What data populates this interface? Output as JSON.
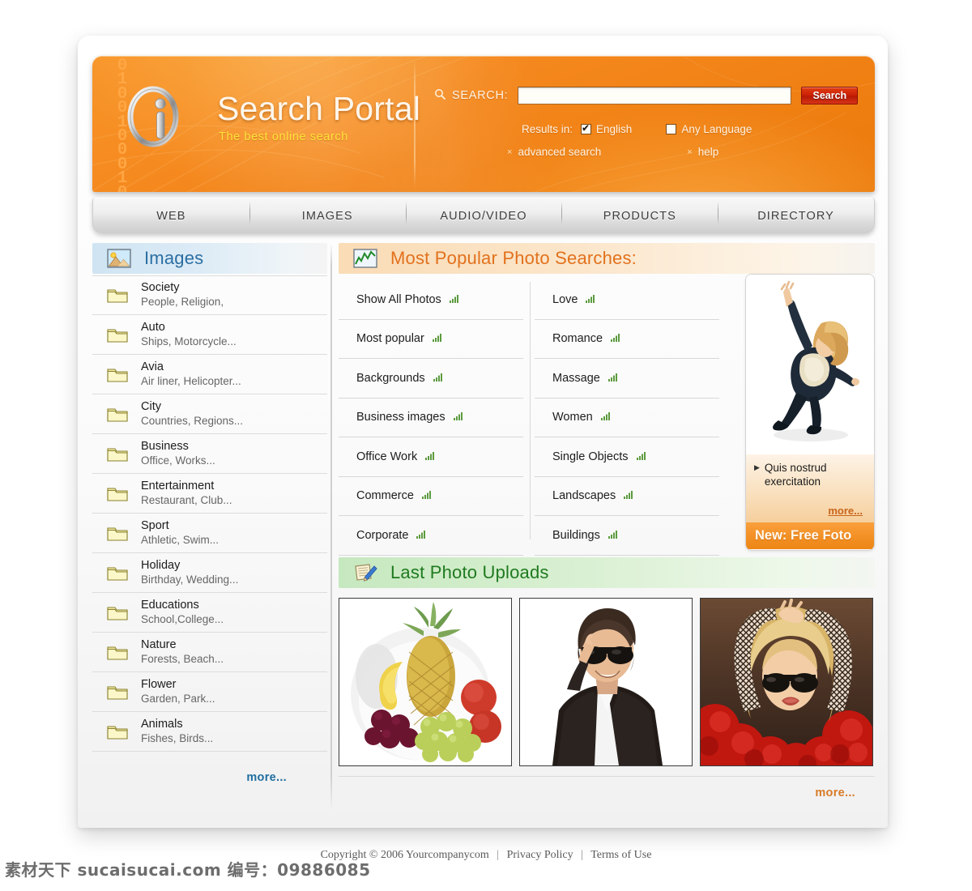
{
  "brand": {
    "title": "Search Portal",
    "tagline": "The best online search",
    "binary": "0\n1\n0\n0\n1\n0\n0\n0\n1\n0",
    "logo_icon": "info-circle-icon"
  },
  "search": {
    "icon": "magnifier-icon",
    "label": "SEARCH:",
    "value": "",
    "placeholder": "",
    "button_label": "Search",
    "results_in_label": "Results in:",
    "options": [
      {
        "label": "English",
        "checked": true
      },
      {
        "label": "Any Language",
        "checked": false
      }
    ],
    "links": [
      {
        "label": "advanced search",
        "bullet": "×"
      },
      {
        "label": "help",
        "bullet": "×"
      }
    ]
  },
  "nav": {
    "tabs": [
      {
        "label": "WEB"
      },
      {
        "label": "IMAGES"
      },
      {
        "label": "AUDIO/VIDEO"
      },
      {
        "label": "PRODUCTS"
      },
      {
        "label": "DIRECTORY"
      }
    ]
  },
  "sidebar": {
    "header": {
      "title": "Images",
      "icon": "picture-landscape-icon"
    },
    "items": [
      {
        "title": "Society",
        "sub": "People, Religion,"
      },
      {
        "title": "Auto",
        "sub": "Ships, Motorcycle..."
      },
      {
        "title": "Avia",
        "sub": "Air liner, Helicopter..."
      },
      {
        "title": "City",
        "sub": "Countries, Regions..."
      },
      {
        "title": "Business",
        "sub": "Office, Works..."
      },
      {
        "title": "Entertainment",
        "sub": "Restaurant, Club..."
      },
      {
        "title": "Sport",
        "sub": "Athletic, Swim..."
      },
      {
        "title": "Holiday",
        "sub": "Birthday, Wedding..."
      },
      {
        "title": "Educations",
        "sub": "School,College..."
      },
      {
        "title": "Nature",
        "sub": "Forests, Beach..."
      },
      {
        "title": "Flower",
        "sub": "Garden, Park..."
      },
      {
        "title": "Animals",
        "sub": "Fishes, Birds..."
      }
    ],
    "more_label": "more..."
  },
  "popular": {
    "header": {
      "title": "Most Popular Photo Searches:",
      "icon": "chart-line-icon"
    },
    "left_column": [
      {
        "label": "Show All Photos"
      },
      {
        "label": "Most popular"
      },
      {
        "label": "Backgrounds"
      },
      {
        "label": "Business images"
      },
      {
        "label": "Office Work"
      },
      {
        "label": "Commerce"
      },
      {
        "label": "Corporate"
      }
    ],
    "right_column": [
      {
        "label": "Love"
      },
      {
        "label": "Romance"
      },
      {
        "label": "Massage"
      },
      {
        "label": "Women"
      },
      {
        "label": "Single Objects"
      },
      {
        "label": "Landscapes"
      },
      {
        "label": "Buildings"
      }
    ],
    "item_icon": "green-bars-icon"
  },
  "promo": {
    "image_alt": "dancing-woman-photo",
    "text": "Quis nostrud exercitation",
    "more_label": "more...",
    "banner_label": "New: Free Foto"
  },
  "uploads": {
    "header": {
      "title": "Last Photo Uploads",
      "icon": "notepad-pencil-icon"
    },
    "thumbs": [
      {
        "alt": "fruit-bowl-photo"
      },
      {
        "alt": "man-with-sunglasses-photo"
      },
      {
        "alt": "blonde-woman-sunglasses-photo"
      }
    ],
    "more_label": "more..."
  },
  "footer": {
    "copyright": "Copyright © 2006 Yourcompanycom",
    "links": [
      {
        "label": "Privacy Policy"
      },
      {
        "label": "Terms of Use"
      }
    ],
    "separator": "|"
  },
  "watermark": {
    "text": "素材天下 sucaisucai.com 编号：09886085"
  },
  "colors": {
    "orange": "#f0820f",
    "red_button": "#cd2207",
    "sidebar_blue": "#2b6ea3",
    "header_orange_text": "#e2711d",
    "green_text": "#1f7a1f",
    "promo_banner": "#f39024"
  }
}
